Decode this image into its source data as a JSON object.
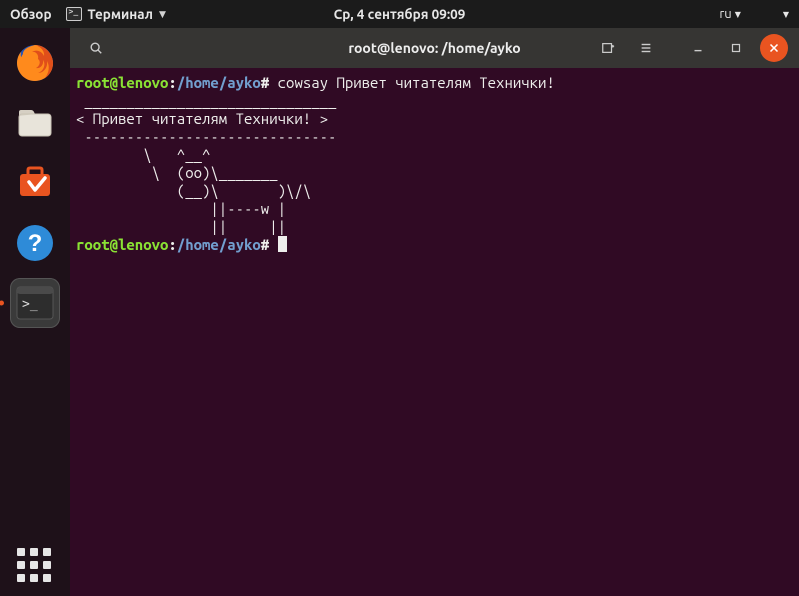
{
  "topbar": {
    "activities": "Обзор",
    "app_name": "Терминал",
    "datetime": "Ср, 4 сентября  09:09",
    "lang": "ru"
  },
  "dock": {
    "items": [
      {
        "name": "firefox-icon"
      },
      {
        "name": "files-icon"
      },
      {
        "name": "software-icon"
      },
      {
        "name": "help-icon"
      },
      {
        "name": "terminal-icon",
        "active": true
      }
    ]
  },
  "window": {
    "title": "root@lenovo: /home/ayko"
  },
  "terminal": {
    "prompt_user": "root@lenovo",
    "prompt_sep1": ":",
    "prompt_path": "/home/ayko",
    "prompt_sep2": "#",
    "command1": "cowsay Привет читателям Технички!",
    "output": " ______________________________\n< Привет читателям Технички! >\n ------------------------------\n        \\   ^__^\n         \\  (oo)\\_______\n            (__)\\       )\\/\\\n                ||----w |\n                ||     ||",
    "command2": ""
  }
}
